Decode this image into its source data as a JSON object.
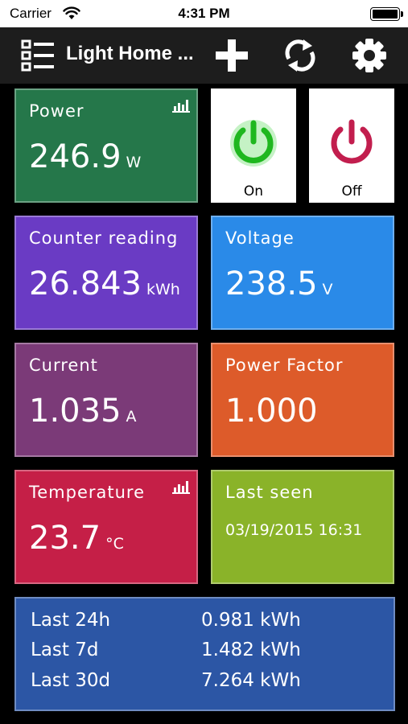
{
  "status_bar": {
    "carrier": "Carrier",
    "time": "4:31 PM",
    "battery_level": 1.0
  },
  "nav": {
    "title": "Light Home ...",
    "icons": [
      "list-icon",
      "plus-icon",
      "refresh-icon",
      "gear-icon"
    ]
  },
  "tiles": {
    "power": {
      "label": "Power",
      "value": "246.9",
      "unit": "W",
      "color": "#25774a"
    },
    "on_button": {
      "label": "On",
      "color": "#1fb71f"
    },
    "off_button": {
      "label": "Off",
      "color": "#c21e4e"
    },
    "counter": {
      "label": "Counter reading",
      "value": "26.843",
      "unit": "kWh",
      "color": "#6a3bc4"
    },
    "voltage": {
      "label": "Voltage",
      "value": "238.5",
      "unit": "V",
      "color": "#2a8ae8"
    },
    "current": {
      "label": "Current",
      "value": "1.035",
      "unit": "A",
      "color": "#7b3a78"
    },
    "power_factor": {
      "label": "Power Factor",
      "value": "1.000",
      "color": "#dd5b2a"
    },
    "temperature": {
      "label": "Temperature",
      "value": "23.7",
      "unit": "°C",
      "color": "#c51f47"
    },
    "last_seen": {
      "label": "Last seen",
      "value": "03/19/2015 16:31",
      "color": "#8ab329"
    }
  },
  "summary": {
    "color": "#2c56a5",
    "rows": [
      {
        "period": "Last 24h",
        "amount": "0.981 kWh"
      },
      {
        "period": "Last 7d",
        "amount": "1.482 kWh"
      },
      {
        "period": "Last 30d",
        "amount": "7.264 kWh"
      }
    ]
  }
}
